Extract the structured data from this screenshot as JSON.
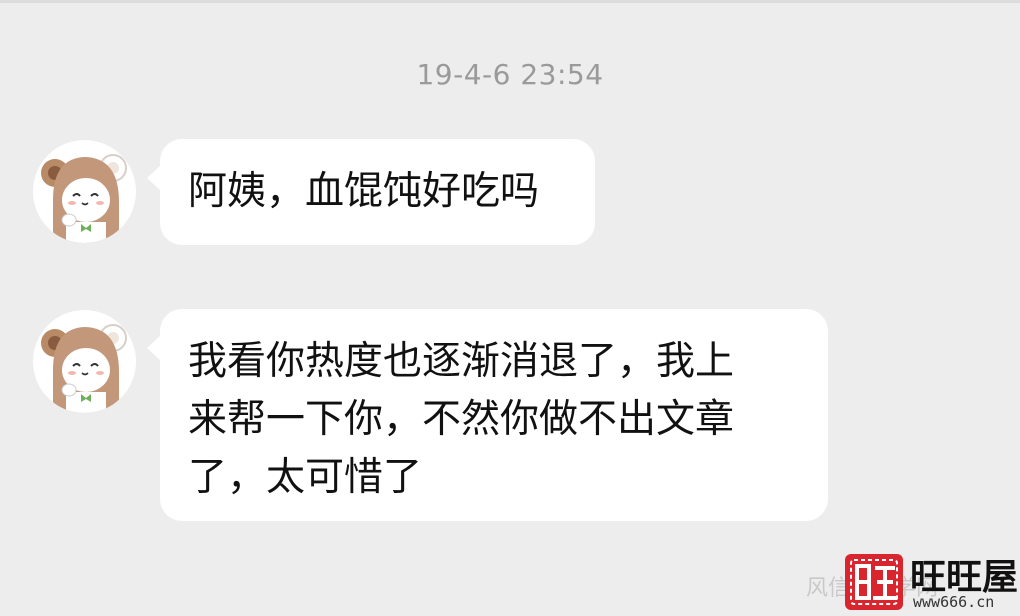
{
  "chat": {
    "timestamp": "19-4-6 23:54",
    "messages": [
      {
        "sender_avatar": "bear-costume-avatar-icon",
        "lines": [
          "阿姨，血馄饨好吃吗"
        ]
      },
      {
        "sender_avatar": "bear-costume-avatar-icon",
        "lines": [
          "我看你热度也逐渐消退了，我上",
          "来帮一下你，不然你做不出文章",
          "了，太可惜了"
        ]
      }
    ]
  },
  "watermark": {
    "site_text": "风信子文学网",
    "brand": "旺旺屋",
    "url": "www666.cn",
    "logo_glyph": "旺"
  },
  "colors": {
    "background": "#ededed",
    "bubble": "#ffffff",
    "timestamp": "#9a9a9a",
    "text": "#111111",
    "logo_red": "#d9262e"
  }
}
